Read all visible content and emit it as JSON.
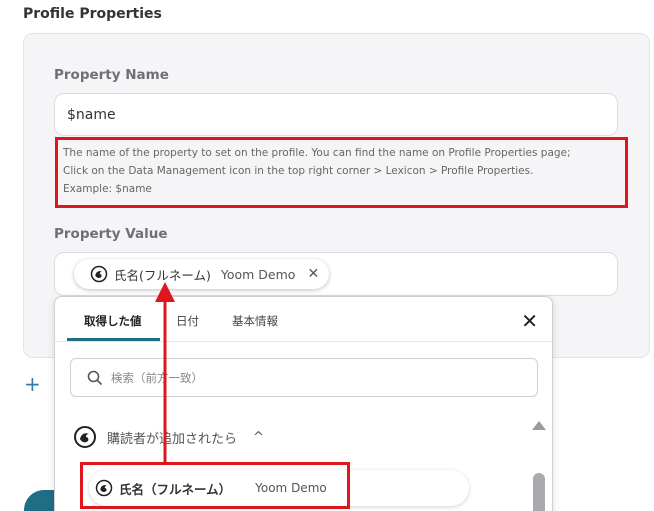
{
  "section": {
    "title": "Profile Properties"
  },
  "property_name": {
    "label": "Property Name",
    "value": "$name",
    "help_line1": "The name of the property to set on the profile. You can find the name on Profile Properties page;",
    "help_line2": "Click on the Data Management icon in the top right corner > Lexicon > Profile Properties.",
    "help_line3": "Example: $name"
  },
  "property_value": {
    "label": "Property Value",
    "chip": {
      "name": "氏名(フルネーム)",
      "app": "Yoom Demo",
      "close": "✕"
    }
  },
  "add_icon": "+",
  "dropdown": {
    "tabs": [
      {
        "label": "取得した値"
      },
      {
        "label": "日付"
      },
      {
        "label": "基本情報"
      }
    ],
    "close": "✕",
    "search_placeholder": "検索（前方一致）",
    "group": {
      "label": "購読者が追加されたら",
      "chevron": "^"
    },
    "item": {
      "name": "氏名（フルネーム）",
      "app": "Yoom Demo"
    }
  },
  "colors": {
    "accent": "#1e6e86",
    "highlight": "#e0161e",
    "link": "#2d7ea6"
  }
}
